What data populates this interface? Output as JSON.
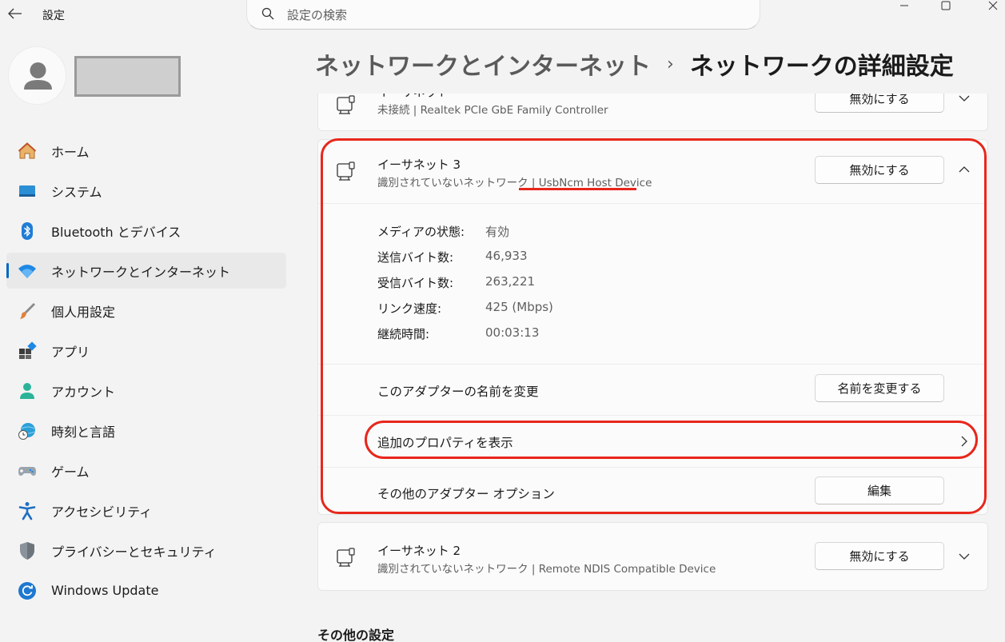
{
  "app": {
    "title": "設定"
  },
  "search": {
    "placeholder": "設定の検索"
  },
  "sidebar": {
    "items": [
      {
        "label": "ホーム",
        "icon": "home-icon"
      },
      {
        "label": "システム",
        "icon": "system-icon"
      },
      {
        "label": "Bluetooth とデバイス",
        "icon": "bluetooth-icon"
      },
      {
        "label": "ネットワークとインターネット",
        "icon": "wifi-icon",
        "active": true
      },
      {
        "label": "個人用設定",
        "icon": "brush-icon"
      },
      {
        "label": "アプリ",
        "icon": "apps-icon"
      },
      {
        "label": "アカウント",
        "icon": "account-icon"
      },
      {
        "label": "時刻と言語",
        "icon": "globe-clock-icon"
      },
      {
        "label": "ゲーム",
        "icon": "gamepad-icon"
      },
      {
        "label": "アクセシビリティ",
        "icon": "accessibility-icon"
      },
      {
        "label": "プライバシーとセキュリティ",
        "icon": "shield-icon"
      },
      {
        "label": "Windows Update",
        "icon": "update-icon"
      }
    ]
  },
  "breadcrumb": {
    "parent": "ネットワークとインターネット",
    "separator": "›",
    "current": "ネットワークの詳細設定"
  },
  "adapters": {
    "top": {
      "name": "イーサネット",
      "desc": "未接続 | Realtek PCIe GbE Family Controller",
      "button": "無効にする"
    },
    "expanded": {
      "name": "イーサネット 3",
      "desc_prefix": "識別されていないネットワーク | ",
      "desc_device": "UsbNcm Host Device",
      "button": "無効にする",
      "properties": [
        {
          "label": "メディアの状態:",
          "value": "有効"
        },
        {
          "label": "送信バイト数:",
          "value": "46,933"
        },
        {
          "label": "受信バイト数:",
          "value": "263,221"
        },
        {
          "label": "リンク速度:",
          "value": "425 (Mbps)"
        },
        {
          "label": "継続時間:",
          "value": "00:03:13"
        }
      ],
      "rename_label": "このアダプターの名前を変更",
      "rename_button": "名前を変更する",
      "more_props_label": "追加のプロパティを表示",
      "other_options_label": "その他のアダプター オプション",
      "edit_button": "編集"
    },
    "bottom": {
      "name": "イーサネット 2",
      "desc": "識別されていないネットワーク | Remote NDIS Compatible Device",
      "button": "無効にする"
    }
  },
  "other_settings": {
    "title": "その他の設定"
  },
  "colors": {
    "accent": "#0067c0",
    "highlight": "#e8261b"
  }
}
